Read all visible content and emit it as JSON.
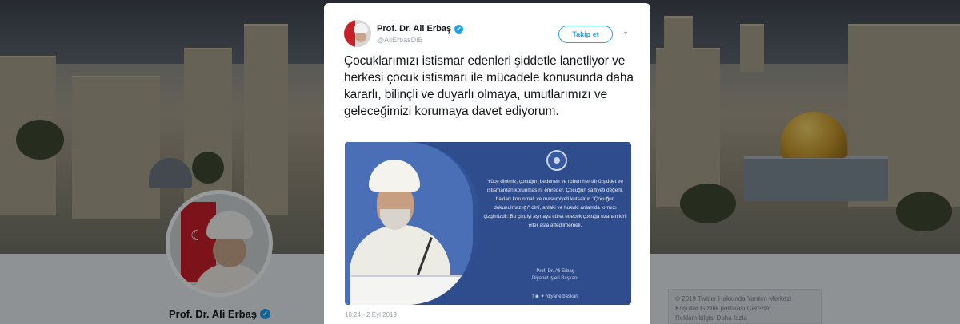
{
  "profile": {
    "name": "Prof. Dr. Ali Erbaş",
    "verified_icon": "verified-badge-icon"
  },
  "side_box": {
    "lines": [
      "© 2019 Twitter  Hakkında  Yardım Merkezi",
      "Koşullar  Gizlilik politikası  Çerezler",
      "Reklam bilgisi  Daha fazla"
    ]
  },
  "tweet": {
    "author_name": "Prof. Dr. Ali Erbaş",
    "author_handle": "@AliErbasDIB",
    "follow_label": "Takip et",
    "text": "Çocuklarımızı istismar edenleri şiddetle lanetliyor ve herkesi çocuk istismarı ile mücadele konusunda daha kararlı, bilinçli ve duyarlı olmaya, umutlarımızı ve geleceğimizi korumaya davet ediyorum.",
    "image": {
      "quote": "Yüce dinimiz, çocuğun bedenen ve ruhen her türlü şiddet ve istismardan korunmasını emreder. Çocuğun saffiyeti değerli, hakları korunmalı ve masumiyeti kutsaldır. \"Çocuğun dokunulmazlığı\" dinî, ahlaki ve hukuki anlamda kırmızı çizgimizdir. Bu çizgiyi aşmaya cüret edecek çocuğa uzanan kirli eller asla affedilmemeli.",
      "signature": "Prof. Dr. Ali Erbaş\nDiyanet İşleri Başkanı",
      "social": "f  ◉  ✦  /diyanetbaskan"
    },
    "timestamp": "10:24 - 2 Eyl 2019"
  },
  "colors": {
    "accent": "#1da1f2",
    "image_bg": "#2f4d8c"
  }
}
